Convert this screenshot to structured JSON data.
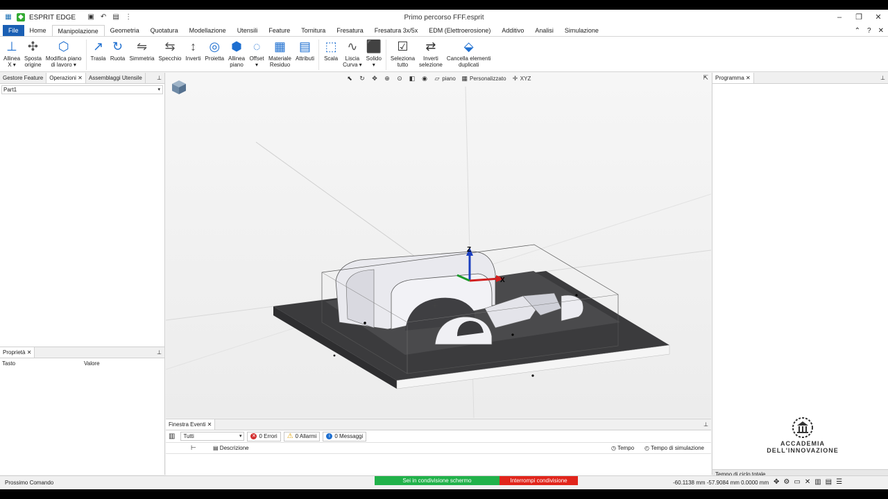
{
  "titlebar": {
    "app_name": "ESPRIT EDGE",
    "title": "Primo percorso FFF.esprit"
  },
  "menu": {
    "file": "File",
    "tabs": [
      "Home",
      "Manipolazione",
      "Geometria",
      "Quotatura",
      "Modellazione",
      "Utensili",
      "Feature",
      "Tornitura",
      "Fresatura",
      "Fresatura 3x/5x",
      "EDM (Elettroerosione)",
      "Additivo",
      "Analisi",
      "Simulazione"
    ],
    "active": "Manipolazione"
  },
  "ribbon": [
    {
      "label": "Allinea\nX ▾",
      "icon": "align-icon"
    },
    {
      "label": "Sposta\norigine",
      "icon": "move-origin-icon"
    },
    {
      "label": "Modifica piano\ndi lavoro ▾",
      "icon": "work-plane-icon"
    },
    {
      "label": "Trasla",
      "icon": "translate-icon"
    },
    {
      "label": "Ruota",
      "icon": "rotate-icon"
    },
    {
      "label": "Simmetria",
      "icon": "mirror-icon"
    },
    {
      "label": "Specchio",
      "icon": "reflect-icon"
    },
    {
      "label": "Inverti",
      "icon": "invert-icon"
    },
    {
      "label": "Proietta",
      "icon": "project-icon"
    },
    {
      "label": "Allinea\npiano",
      "icon": "align-plane-icon"
    },
    {
      "label": "Offset\n▾",
      "icon": "offset-icon"
    },
    {
      "label": "Materiale\nResiduo",
      "icon": "residual-material-icon"
    },
    {
      "label": "Attributi",
      "icon": "attributes-icon"
    },
    {
      "label": "Scala",
      "icon": "scale-icon"
    },
    {
      "label": "Liscia\nCurva ▾",
      "icon": "smooth-curve-icon"
    },
    {
      "label": "Solido\n▾",
      "icon": "solid-icon"
    },
    {
      "label": "Seleziona\ntutto",
      "icon": "select-all-icon"
    },
    {
      "label": "Inverti\nselezione",
      "icon": "invert-selection-icon"
    },
    {
      "label": "Cancella elementi\nduplicati",
      "icon": "delete-duplicates-icon"
    }
  ],
  "left_panel": {
    "tabs": [
      "Gestore Feature",
      "Operazioni",
      "Assemblaggi Utensile"
    ],
    "active_tab": "Operazioni",
    "combo": "Part1",
    "props_tab": "Proprietà",
    "props_cols": [
      "Tasto",
      "Valore"
    ]
  },
  "viewport": {
    "tools": {
      "plane": "piano",
      "custom": "Personalizzato",
      "xyz": "XYZ"
    },
    "axes": {
      "x": "X",
      "z": "Z"
    }
  },
  "right_panel": {
    "tab": "Programma",
    "logo_line1": "ACCADEMIA",
    "logo_line2": "DELL'INNOVAZIONE",
    "cycle": "Tempo di ciclo totale"
  },
  "events": {
    "tab": "Finestra Eventi",
    "filter": "Tutti",
    "errors": "0 Errori",
    "alarms": "0 Allarmi",
    "messages": "0 Messaggi",
    "col_desc": "Descrizione",
    "col_time": "Tempo",
    "col_sim": "Tempo di simulazione"
  },
  "status": {
    "command": "Prossimo Comando",
    "share": "Sei in condivisione schermo",
    "stop": "Interrompi condivisione",
    "coords": "-60.1138 mm  -57.9084 mm  0.0000 mm"
  },
  "colors": {
    "file_tab": "#1a5fb4",
    "share_green": "#21b24a",
    "stop_red": "#e1251b"
  }
}
